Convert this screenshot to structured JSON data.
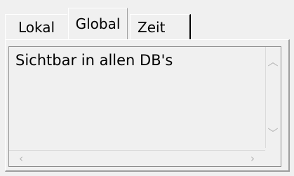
{
  "tabs": [
    {
      "label": "Lokal",
      "active": false
    },
    {
      "label": "Global",
      "active": true
    },
    {
      "label": "Zeit",
      "active": false
    }
  ],
  "content": {
    "text": "Sichtbar in allen DB's"
  },
  "icons": {
    "scroll_up": "chevron-up-icon",
    "scroll_down": "chevron-down-icon",
    "scroll_left": "chevron-left-icon",
    "scroll_right": "chevron-right-icon"
  },
  "colors": {
    "background": "#f0f0f0",
    "border": "#8c8c8c",
    "text": "#000000",
    "muted_icon": "#b5b5b5"
  }
}
